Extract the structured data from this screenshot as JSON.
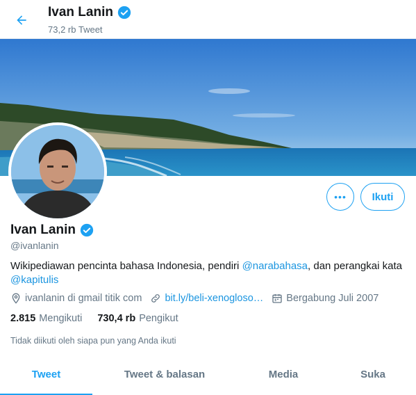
{
  "header": {
    "name": "Ivan Lanin",
    "tweet_count": "73,2 rb Tweet"
  },
  "profile": {
    "name": "Ivan Lanin",
    "handle": "@ivanlanin",
    "bio_text": "Wikipediawan pencinta bahasa Indonesia, pendiri ",
    "bio_mention1": "@narabahasa",
    "bio_mid": ", dan perangkai kata ",
    "bio_mention2": "@kapitulis",
    "location": "ivanlanin di gmail titik com",
    "website": "bit.ly/beli-xenogloso…",
    "joined": "Bergabung Juli 2007",
    "following_count": "2.815",
    "following_label": "Mengikuti",
    "followers_count": "730,4 rb",
    "followers_label": "Pengikut",
    "followed_by_note": "Tidak diikuti oleh siapa pun yang Anda ikuti"
  },
  "actions": {
    "more_label": "•••",
    "follow_label": "Ikuti"
  },
  "tabs": [
    {
      "label": "Tweet",
      "active": true
    },
    {
      "label": "Tweet & balasan",
      "active": false
    },
    {
      "label": "Media",
      "active": false
    },
    {
      "label": "Suka",
      "active": false
    }
  ],
  "colors": {
    "accent": "#1da1f2",
    "link": "#1b95e0",
    "muted": "#657786"
  }
}
